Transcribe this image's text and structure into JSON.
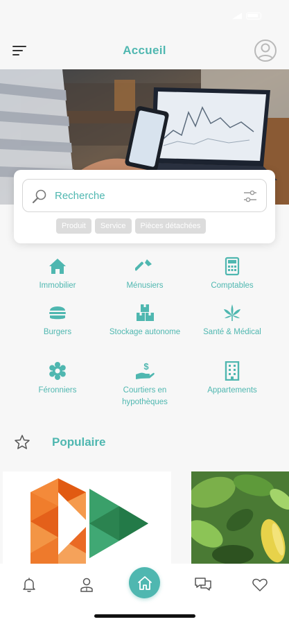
{
  "colors": {
    "accent": "#4fb7b0",
    "chip_bg": "#dcdcdc",
    "background": "#f7f7f7"
  },
  "header": {
    "title": "Accueil"
  },
  "search": {
    "placeholder": "Recherche",
    "chips": [
      "Produit",
      "Service",
      "Pièces détachées"
    ]
  },
  "categories": [
    {
      "label": "Immobilier",
      "icon": "home-icon"
    },
    {
      "label": "Ménusiers",
      "icon": "screwdriver-icon"
    },
    {
      "label": "Comptables",
      "icon": "calculator-icon"
    },
    {
      "label": "Burgers",
      "icon": "burger-icon"
    },
    {
      "label": "Stockage autonome",
      "icon": "boxes-icon"
    },
    {
      "label": "Santé & Médical",
      "icon": "cannabis-leaf-icon"
    },
    {
      "label": "Féronniers",
      "icon": "gear-flower-icon"
    },
    {
      "label": "Courtiers en hypothèques",
      "icon": "hand-dollar-icon"
    },
    {
      "label": "Appartements",
      "icon": "building-icon"
    }
  ],
  "popular": {
    "title": "Populaire"
  },
  "bottom_nav": [
    "bell-icon",
    "user-icon",
    "home-icon",
    "chat-icon",
    "heart-icon"
  ]
}
